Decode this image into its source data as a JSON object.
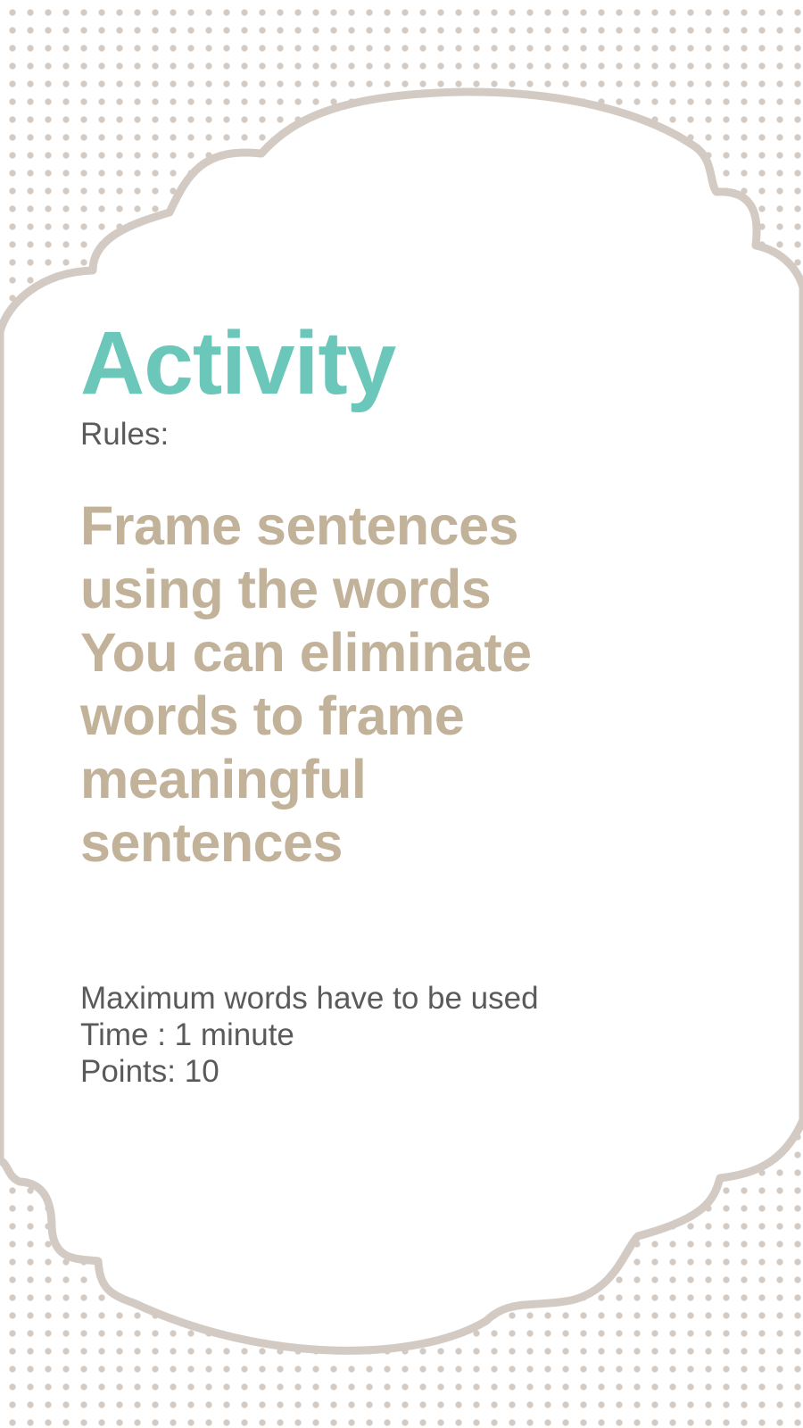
{
  "colors": {
    "accent": "#6cc7bb",
    "instruction_text": "#c1b299",
    "body_text": "#5a5a5a",
    "frame_stroke": "#d3cbc3",
    "dot_pattern": "#d3cbc3",
    "background": "#ffffff"
  },
  "card": {
    "title": "Activity",
    "rules_label": "Rules:",
    "instructions": [
      "Frame sentences",
      "using the words",
      "You can eliminate",
      "words to frame",
      "meaningful",
      "sentences"
    ],
    "details": [
      "Maximum words have to be used",
      "Time : 1 minute",
      "Points: 10"
    ]
  }
}
